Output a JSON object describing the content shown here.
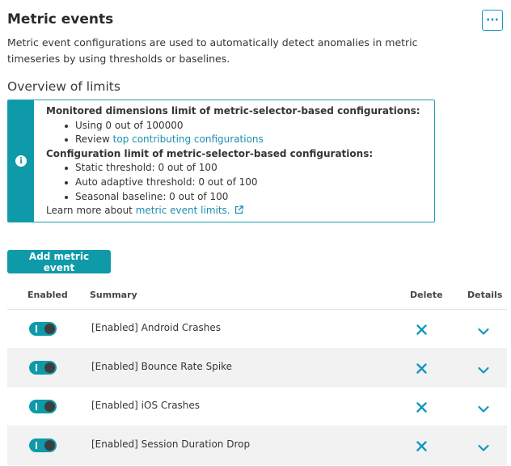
{
  "header": {
    "title": "Metric events",
    "more_label": "···",
    "description": "Metric event configurations are used to automatically detect anomalies in metric timeseries by using thresholds or baselines."
  },
  "limits": {
    "title": "Overview of limits",
    "icon": "info-icon",
    "dimensions_heading": "Monitored dimensions limit of metric-selector-based configurations:",
    "using": "Using 0 out of 100000",
    "review_prefix": "Review ",
    "review_link": "top contributing configurations",
    "config_heading": "Configuration limit of metric-selector-based configurations:",
    "static": "Static threshold: 0 out of 100",
    "auto": "Auto adaptive threshold: 0 out of 100",
    "seasonal": "Seasonal baseline: 0 out of 100",
    "learn_prefix": "Learn more about ",
    "learn_link": "metric event limits.",
    "learn_icon": "external-link-icon"
  },
  "add_button": "Add metric event",
  "table": {
    "columns": {
      "enabled": "Enabled",
      "summary": "Summary",
      "delete": "Delete",
      "details": "Details"
    },
    "rows": [
      {
        "enabled": true,
        "summary": "[Enabled] Android Crashes"
      },
      {
        "enabled": true,
        "summary": "[Enabled] Bounce Rate Spike"
      },
      {
        "enabled": true,
        "summary": "[Enabled] iOS Crashes"
      },
      {
        "enabled": true,
        "summary": "[Enabled] Session Duration Drop"
      }
    ]
  },
  "colors": {
    "accent": "#0e9aa9",
    "link": "#1b8fb0",
    "row_alt": "#f2f2f2"
  }
}
